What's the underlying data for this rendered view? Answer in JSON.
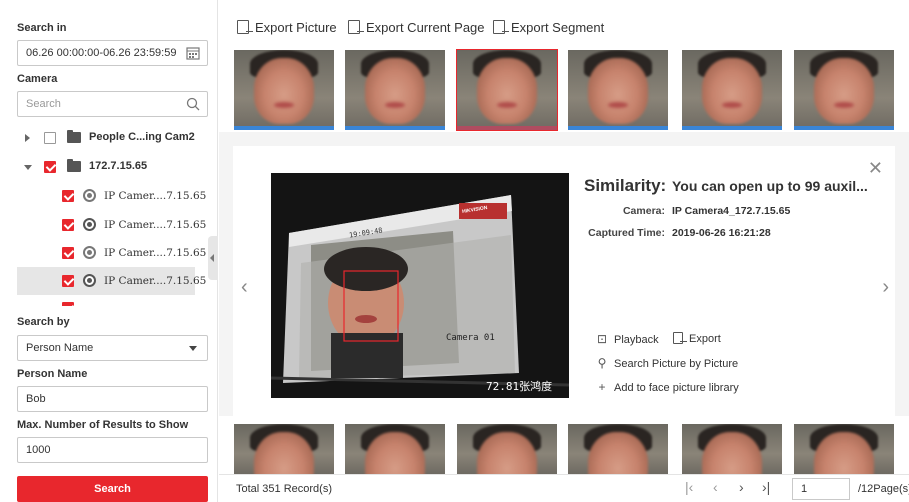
{
  "left": {
    "search_in_label": "Search in",
    "date_range": "06.26 00:00:00-06.26 23:59:59",
    "camera_label": "Camera",
    "camera_search_placeholder": "Search",
    "tree": [
      {
        "label": "People C...ing Cam2",
        "type": "group",
        "checked": false,
        "expanded": false
      },
      {
        "label": "172.7.15.65",
        "type": "group",
        "checked": true,
        "expanded": true
      },
      {
        "label": "IP Camer....7.15.65",
        "type": "camera",
        "checked": true
      },
      {
        "label": "IP Camer....7.15.65",
        "type": "camera",
        "checked": true
      },
      {
        "label": "IP Camer....7.15.65",
        "type": "camera",
        "checked": true
      },
      {
        "label": "IP Camer....7.15.65",
        "type": "camera",
        "checked": true,
        "selected": true
      }
    ],
    "search_by_label": "Search by",
    "search_by_value": "Person Name",
    "person_name_label": "Person Name",
    "person_name_value": "Bob",
    "max_results_label": "Max. Number of Results to Show",
    "max_results_value": "1000",
    "search_button": "Search"
  },
  "toolbar": {
    "export_picture": "Export Picture",
    "export_current_page": "Export Current Page",
    "export_segment": "Export Segment"
  },
  "detail": {
    "similarity_label": "Similarity:",
    "similarity_value": "You can open up to 99 auxil...",
    "camera_key": "Camera:",
    "camera_value": "IP Camera4_172.7.15.65",
    "captured_key": "Captured Time:",
    "captured_value": "2019-06-26 16:21:28",
    "photo_overlay_time": "19:09:48",
    "photo_overlay_cam": "Camera 01",
    "photo_overlay_num": "72.81张鸿度",
    "photo_brand": "HIKVISION",
    "actions": {
      "playback": "Playback",
      "export": "Export",
      "search_by_picture": "Search Picture by Picture",
      "add_to_library": "Add to face picture library"
    }
  },
  "footer": {
    "total": "Total 351 Record(s)",
    "page_value": "1",
    "page_total": "/12Page(s)"
  },
  "colors": {
    "accent": "#e8272d",
    "thumb_bar": "#3a85d6"
  }
}
